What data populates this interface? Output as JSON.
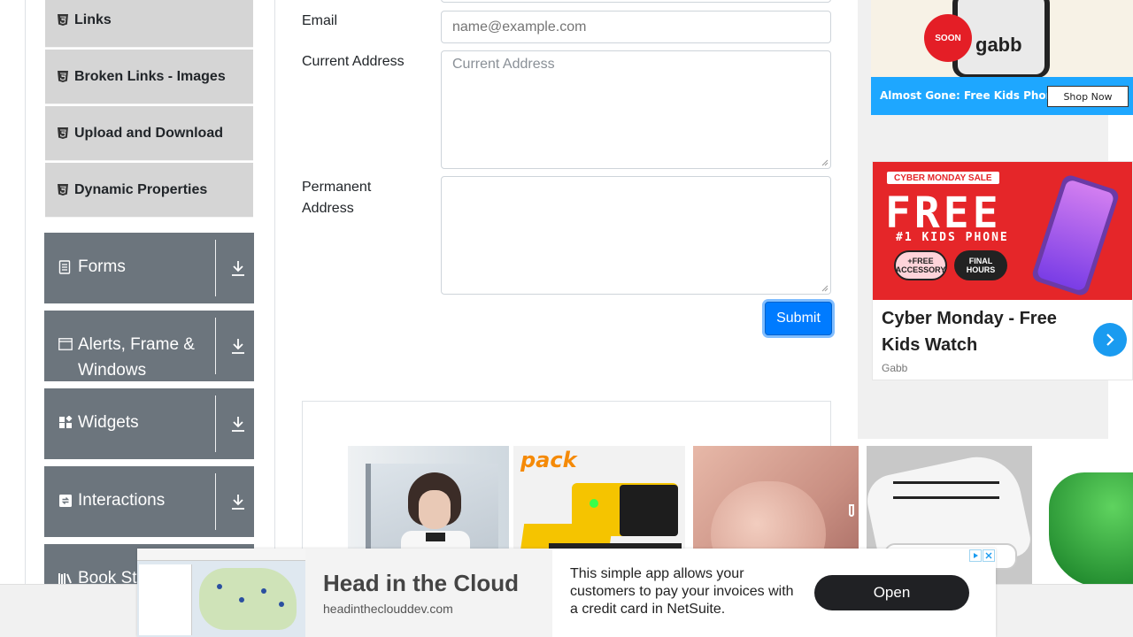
{
  "sidebar": {
    "sub_items": [
      {
        "label": "Links"
      },
      {
        "label": "Broken Links - Images"
      },
      {
        "label": "Upload and Download"
      },
      {
        "label": "Dynamic Properties"
      }
    ],
    "groups": [
      {
        "label": "Forms",
        "icon": "document-icon"
      },
      {
        "label": "Alerts, Frame & Windows",
        "icon": "window-icon"
      },
      {
        "label": "Widgets",
        "icon": "widgets-icon"
      },
      {
        "label": "Interactions",
        "icon": "interactions-icon"
      },
      {
        "label": "Book Store Application",
        "icon": "book-store-icon"
      }
    ]
  },
  "form": {
    "email_label": "Email",
    "email_placeholder": "name@example.com",
    "current_address_label": "Current Address",
    "current_address_placeholder": "Current Address",
    "permanent_address_label": "Permanent Address",
    "submit_label": "Submit"
  },
  "ads": {
    "ad1": {
      "bar_text": "Almost Gone: Free Kids Phone",
      "button": "Shop Now",
      "brand": "gabb",
      "badge": "SOON"
    },
    "ad2": {
      "sale": "CYBER MONDAY SALE",
      "big": "FREE",
      "subtitle": "#1 KIDS PHONE",
      "pill1": "+FREE ACCESSORY",
      "pill2": "FINAL HOURS",
      "headline": "Cyber Monday - Free Kids Watch",
      "brand": "Gabb"
    },
    "strip_text": "pack",
    "banner": {
      "title": "Head in the Cloud",
      "domain": "headintheclouddev.com",
      "description": "This simple app allows your customers to pay your invoices with a credit card in NetSuite.",
      "button": "Open"
    }
  },
  "colors": {
    "accent": "#007bff",
    "group_bg": "#6c757d",
    "sub_bg": "#d5d5d5",
    "ad_blue": "#1ea7ff",
    "ad_red": "#e52629"
  }
}
